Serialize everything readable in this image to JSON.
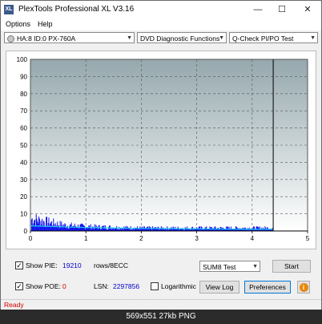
{
  "window": {
    "title": "PlexTools Professional XL V3.16",
    "app_icon_text": "XL"
  },
  "controls": {
    "minimize": "—",
    "maximize": "☐",
    "close": "✕"
  },
  "menu": {
    "items": [
      "Options",
      "Help"
    ]
  },
  "toolbar": {
    "drive": "HA:8 ID:0  PX-760A",
    "function": "DVD Diagnostic Functions",
    "test": "Q-Check PI/PO Test"
  },
  "chart_data": {
    "type": "area",
    "x_ticks": [
      "0",
      "1",
      "2",
      "3",
      "4",
      "5"
    ],
    "y_ticks": [
      "0",
      "10",
      "20",
      "30",
      "40",
      "50",
      "60",
      "70",
      "80",
      "90",
      "100"
    ],
    "xlim": [
      0,
      5
    ],
    "ylim": [
      0,
      100
    ],
    "grid": true,
    "end_marker_x": 4.38,
    "series": [
      {
        "color": "#1010ee",
        "x": [
          0.05,
          0.3,
          0.6,
          1.0,
          2.0,
          3.0,
          4.0,
          4.38
        ],
        "values": [
          8,
          6,
          4,
          3,
          2,
          2,
          2,
          2
        ]
      },
      {
        "color": "#20d0ee",
        "x": [
          0,
          0.5,
          1,
          2,
          3,
          4,
          4.38
        ],
        "values": [
          3,
          2.5,
          2,
          1.5,
          1.2,
          1.0,
          1.0
        ]
      }
    ]
  },
  "bottom": {
    "show_pie_label": "Show PIE:",
    "pie_value": "19210",
    "rows_label": "rows/8ECC",
    "show_poe_label": "Show POE:",
    "poe_value": "0",
    "lsn_label": "LSN:",
    "lsn_value": "2297856",
    "logarithmic_label": "Logarithmic",
    "sum_select": "SUM8 Test",
    "start_button": "Start",
    "view_log_button": "View Log",
    "preferences_button": "Preferences",
    "help_button": "i"
  },
  "status": {
    "text": "Ready"
  },
  "footer": {
    "text": "569x551  27kb  PNG"
  }
}
